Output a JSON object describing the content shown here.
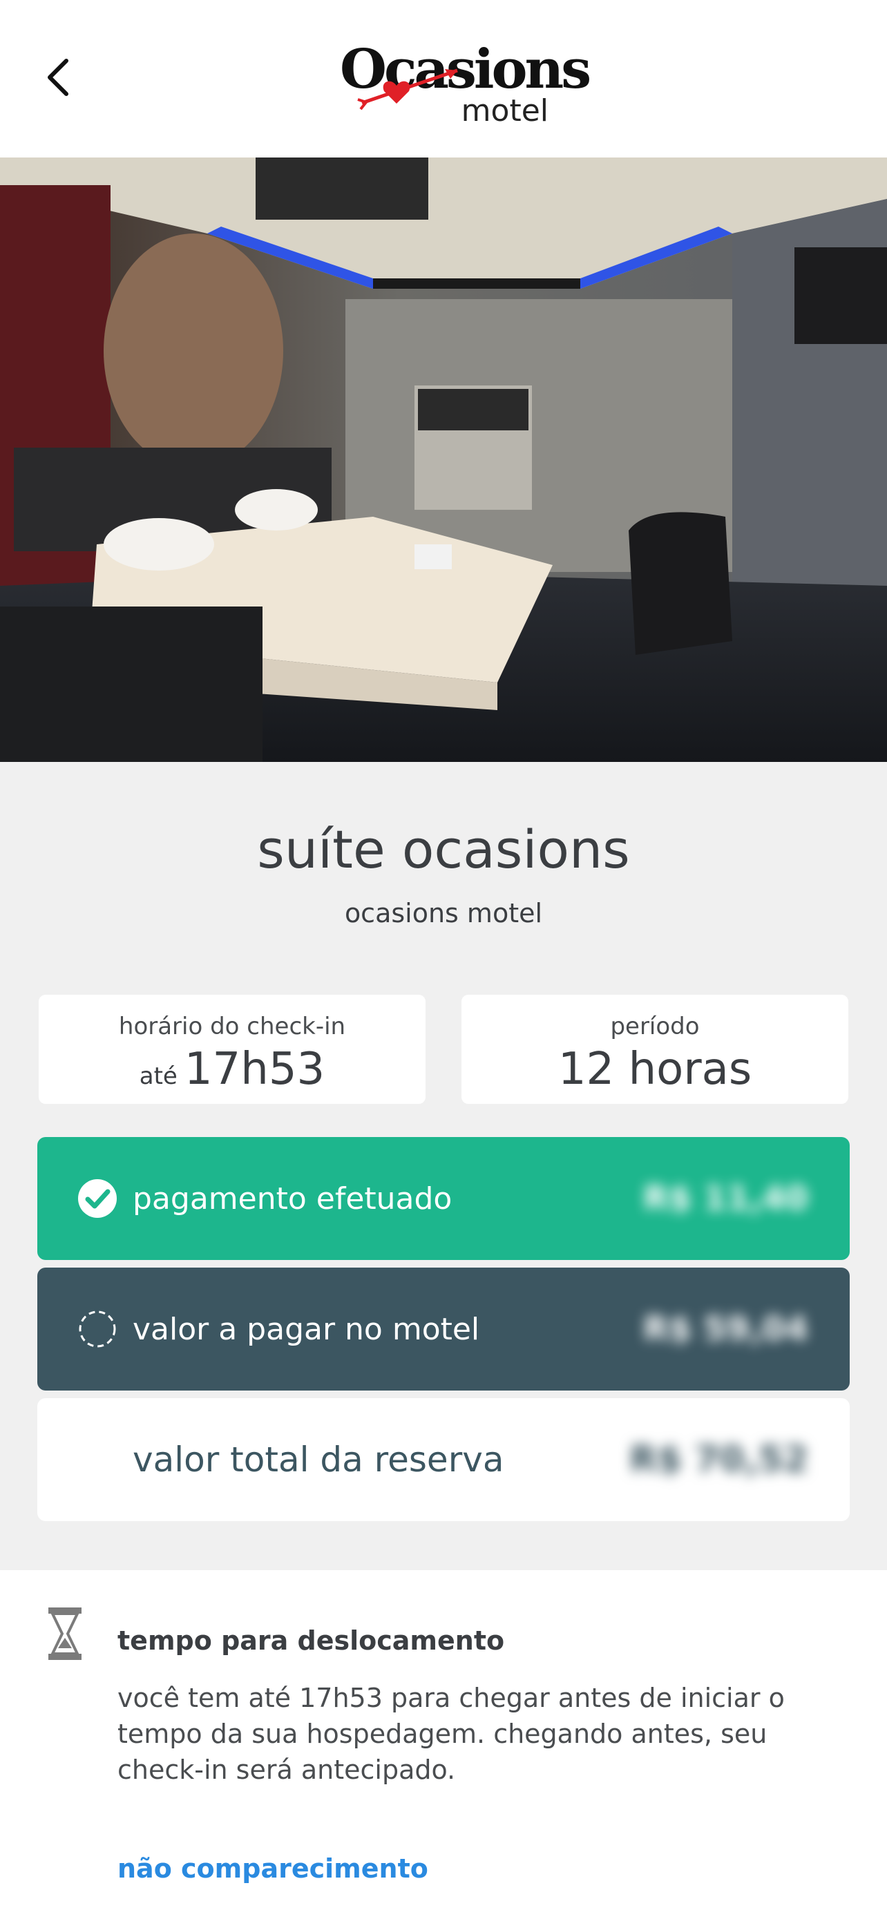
{
  "header": {
    "logo_main": "Ocasions",
    "logo_sub": "motel"
  },
  "suite": {
    "title": "suíte ocasions",
    "subtitle": "ocasions motel"
  },
  "checkin": {
    "label": "horário do check-in",
    "prefix": "até",
    "time": "17h53"
  },
  "period": {
    "label": "período",
    "value": "12 horas"
  },
  "payments": [
    {
      "label": "pagamento efetuado",
      "amount": "R$ 11,40",
      "status": "paid"
    },
    {
      "label": "valor a pagar no motel",
      "amount": "R$ 59,04",
      "status": "pending"
    },
    {
      "label": "valor total da reserva",
      "amount": "R$ 70,52",
      "status": "total"
    }
  ],
  "tempo": {
    "title": "tempo para deslocamento",
    "body": "você tem até 17h53 para chegar antes de iniciar o tempo da sua hospedagem. chegando antes, seu check-in será antecipado."
  },
  "no_show_link": "não comparecimento",
  "colors": {
    "paid": "#1db68d",
    "pending": "#3c5661",
    "link": "#2a8ae0"
  }
}
